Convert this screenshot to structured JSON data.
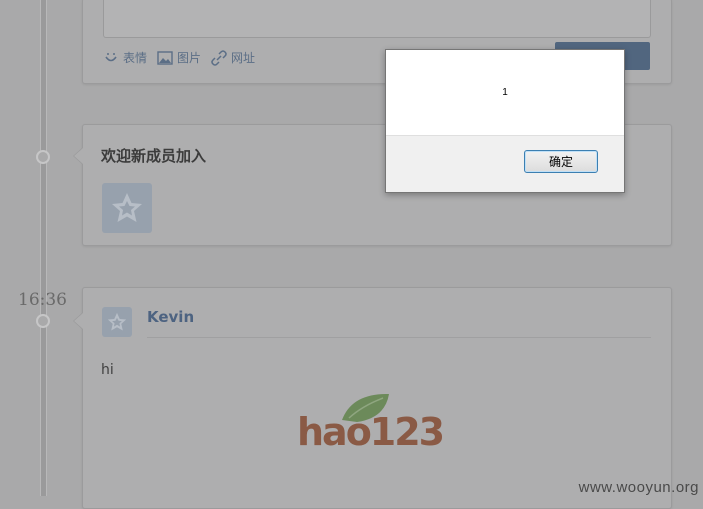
{
  "composer": {
    "tools": [
      {
        "icon": "smiley-icon",
        "label": "表情"
      },
      {
        "icon": "image-icon",
        "label": "图片"
      },
      {
        "icon": "link-icon",
        "label": "网址"
      }
    ]
  },
  "welcome_card": {
    "title": "欢迎新成员加入"
  },
  "timeline": {
    "time": "16:36"
  },
  "post": {
    "author": "Kevin",
    "text": "hi",
    "logo_text": "hao123"
  },
  "watermark": "www.wooyun.org",
  "dialog": {
    "message": "1",
    "ok_label": "确定"
  },
  "colors": {
    "overlay_bg": "#a9a9aa",
    "link_blue": "#4d6381",
    "button_blue": "#51667f",
    "dialog_border": "#3c7fb1"
  }
}
